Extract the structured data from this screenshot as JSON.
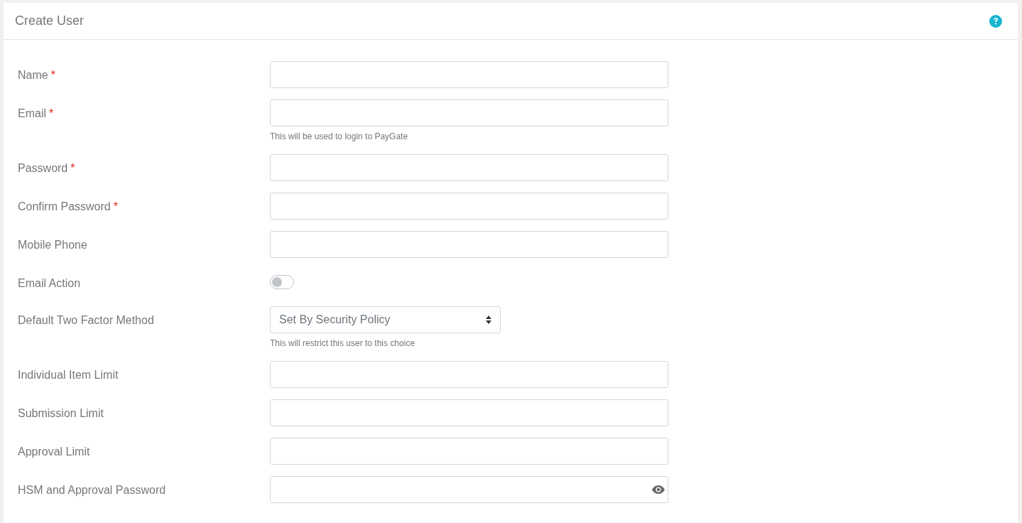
{
  "header": {
    "title": "Create User"
  },
  "fields": [
    {
      "kind": "text",
      "label": "Name",
      "required_mark": "*"
    },
    {
      "kind": "text",
      "label": "Email",
      "required_mark": "*",
      "help": "This will be used to login to PayGate"
    },
    {
      "kind": "text",
      "label": "Password",
      "required_mark": "*"
    },
    {
      "kind": "text",
      "label": "Confirm Password",
      "required_mark": "*"
    },
    {
      "kind": "text",
      "label": "Mobile Phone"
    },
    {
      "kind": "toggle",
      "label": "Email Action",
      "on": false
    },
    {
      "kind": "select",
      "label": "Default Two Factor Method",
      "value": "Set By Security Policy",
      "help": "This will restrict this user to this choice"
    },
    {
      "kind": "text",
      "label": "Individual Item Limit"
    },
    {
      "kind": "text",
      "label": "Submission Limit"
    },
    {
      "kind": "text",
      "label": "Approval Limit"
    },
    {
      "kind": "password",
      "label": "HSM and Approval Password"
    }
  ]
}
